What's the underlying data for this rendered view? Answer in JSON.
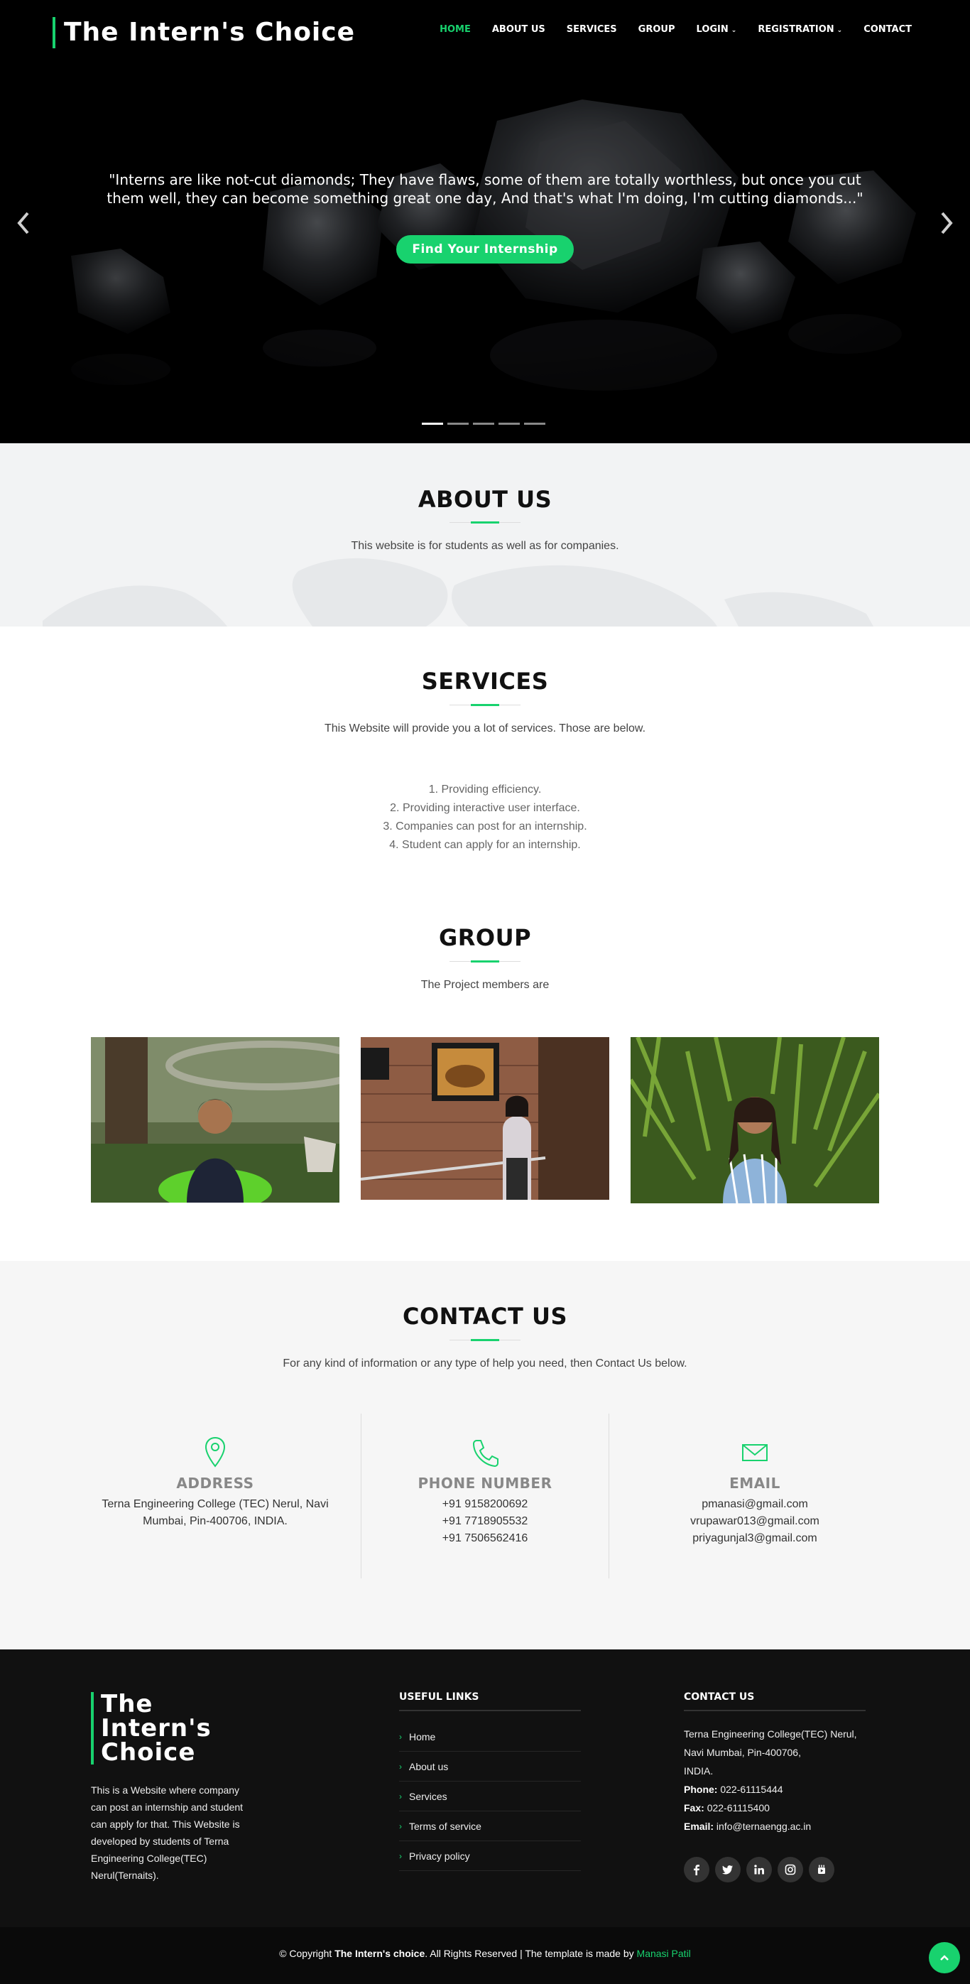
{
  "header": {
    "logo": "The Intern's Choice",
    "nav": [
      {
        "label": "HOME",
        "active": true,
        "dropdown": false
      },
      {
        "label": "ABOUT US",
        "active": false,
        "dropdown": false
      },
      {
        "label": "SERVICES",
        "active": false,
        "dropdown": false
      },
      {
        "label": "GROUP",
        "active": false,
        "dropdown": false
      },
      {
        "label": "LOGIN",
        "active": false,
        "dropdown": true
      },
      {
        "label": "REGISTRATION",
        "active": false,
        "dropdown": true
      },
      {
        "label": "CONTACT",
        "active": false,
        "dropdown": false
      }
    ]
  },
  "hero": {
    "quote_line1": "\"Interns are like not-cut diamonds; They have flaws, some of them are totally worthless, but once you cut",
    "quote_line2": "them well, they can become something great one day, And that's what I'm doing, I'm cutting diamonds...\"",
    "button_label": "Find Your Internship",
    "prev_icon": "chevron-left-icon",
    "next_icon": "chevron-right-icon",
    "slide_count": 5,
    "active_slide": 1
  },
  "about": {
    "title": "ABOUT US",
    "subtitle": "This website is for students as well as for companies."
  },
  "services": {
    "title": "SERVICES",
    "subtitle": "This Website will provide you a lot of services. Those are below.",
    "items": [
      "1. Providing efficiency.",
      "2. Providing interactive user interface.",
      "3. Companies can post for an internship.",
      "4. Student can apply for an internship."
    ]
  },
  "group": {
    "title": "GROUP",
    "subtitle": "The Project members are"
  },
  "contact": {
    "title": "CONTACT US",
    "subtitle": "For any kind of information or any type of help you need, then Contact Us below.",
    "address": {
      "icon": "map-pin-icon",
      "label": "ADDRESS",
      "line1": "Terna Engineering College (TEC) Nerul, Navi",
      "line2": "Mumbai, Pin-400706, INDIA."
    },
    "phone": {
      "icon": "phone-icon",
      "label": "PHONE NUMBER",
      "numbers": [
        "+91 9158200692",
        "+91 7718905532",
        "+91 7506562416"
      ]
    },
    "email": {
      "icon": "envelope-icon",
      "label": "EMAIL",
      "addresses": [
        "pmanasi@gmail.com",
        "vrupawar013@gmail.com",
        "priyagunjal3@gmail.com"
      ]
    }
  },
  "footer": {
    "logo_line1": "The",
    "logo_line2": "Intern's",
    "logo_line3": "Choice",
    "desc_lines": [
      "This is a Website where company",
      "can post an internship and student",
      "can apply for that. This Website is",
      "developed by students of Terna",
      "Engineering College(TEC)",
      "Nerul(Ternaits)."
    ],
    "links_title": "USEFUL LINKS",
    "links": [
      "Home",
      "About us",
      "Services",
      "Terms of service",
      "Privacy policy"
    ],
    "contact_title": "CONTACT US",
    "contact_lines": [
      "Terna Engineering College(TEC) Nerul,",
      "Navi Mumbai, Pin-400706,",
      "INDIA."
    ],
    "phone_label": "Phone:",
    "phone_value": "022-61115444",
    "fax_label": "Fax:",
    "fax_value": "022-61115400",
    "email_label": "Email:",
    "email_value": "info@ternaengg.ac.in",
    "socials": [
      "facebook-icon",
      "twitter-icon",
      "linkedin-icon",
      "instagram-icon",
      "youtube-icon"
    ]
  },
  "bottom": {
    "copy_prefix": "© Copyright",
    "brand": "The Intern's choice",
    "copy_mid": ". All Rights Reserved | The template is made by",
    "author": "Manasi Patil"
  },
  "colors": {
    "accent": "#18d26e",
    "hero_bg": "#000000",
    "footer_bg": "#111111"
  }
}
